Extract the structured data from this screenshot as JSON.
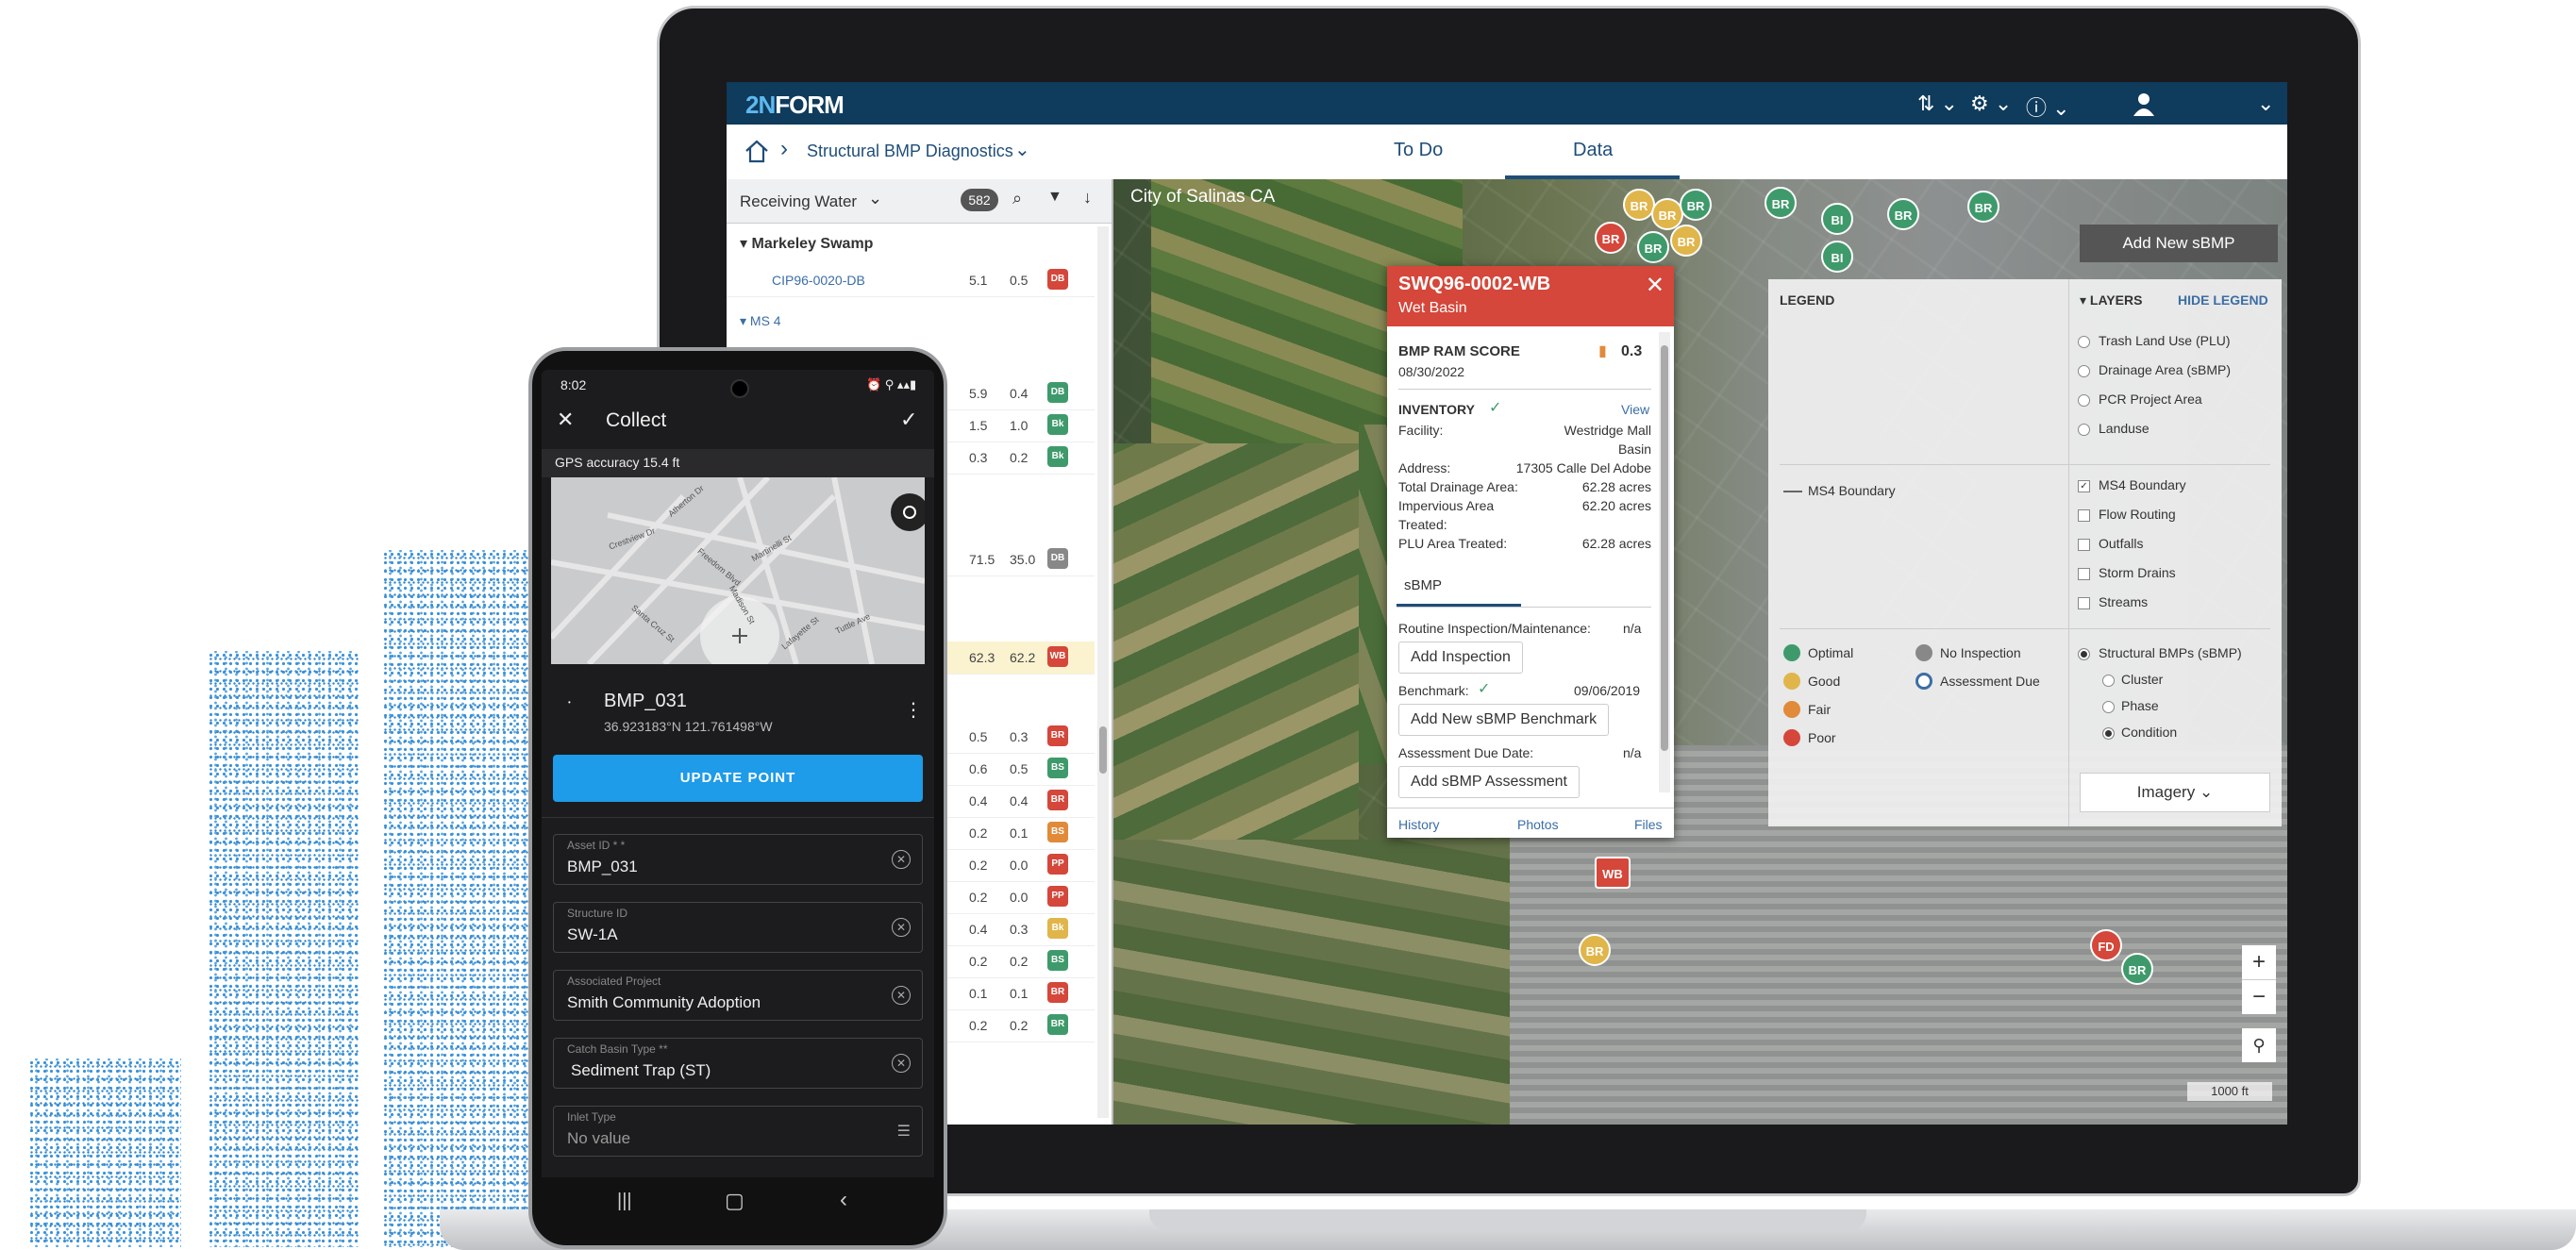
{
  "app": {
    "logo_prefix": "2N",
    "logo_suffix": "FORM",
    "breadcrumb": "Structural BMP Diagnostics",
    "tabs": [
      "To Do",
      "Data"
    ]
  },
  "list": {
    "filter_label": "Receiving Water",
    "count": "582",
    "group1": "Markeley Swamp",
    "group2": "MS 4",
    "rows": [
      {
        "name": "CIP96-0020-DB",
        "v1": "5.1",
        "v2": "0.5",
        "tag": "DB",
        "color": "#d4473a"
      },
      {
        "name": "",
        "v1": "5.9",
        "v2": "0.4",
        "tag": "DB",
        "color": "#3f9a6b"
      },
      {
        "name": "",
        "v1": "1.5",
        "v2": "1.0",
        "tag": "Bk",
        "color": "#3f9a6b"
      },
      {
        "name": "",
        "v1": "0.3",
        "v2": "0.2",
        "tag": "Bk",
        "color": "#3f9a6b"
      },
      {
        "name": "",
        "v1": "71.5",
        "v2": "35.0",
        "tag": "DB",
        "color": "#888888"
      },
      {
        "name": "",
        "v1": "62.3",
        "v2": "62.2",
        "tag": "WB",
        "color": "#d4473a"
      },
      {
        "name": "",
        "v1": "0.5",
        "v2": "0.3",
        "tag": "BR",
        "color": "#d4473a"
      },
      {
        "name": "",
        "v1": "0.6",
        "v2": "0.5",
        "tag": "BS",
        "color": "#3f9a6b"
      },
      {
        "name": "",
        "v1": "0.4",
        "v2": "0.4",
        "tag": "BR",
        "color": "#d4473a"
      },
      {
        "name": "",
        "v1": "0.2",
        "v2": "0.1",
        "tag": "BS",
        "color": "#e08a3a"
      },
      {
        "name": "",
        "v1": "0.2",
        "v2": "0.0",
        "tag": "PP",
        "color": "#d4473a"
      },
      {
        "name": "",
        "v1": "0.2",
        "v2": "0.0",
        "tag": "PP",
        "color": "#d4473a"
      },
      {
        "name": "",
        "v1": "0.4",
        "v2": "0.3",
        "tag": "Bk",
        "color": "#e0b54a"
      },
      {
        "name": "",
        "v1": "0.2",
        "v2": "0.2",
        "tag": "BS",
        "color": "#3f9a6b"
      },
      {
        "name": "",
        "v1": "0.1",
        "v2": "0.1",
        "tag": "BR",
        "color": "#d4473a"
      },
      {
        "name": "",
        "v1": "0.2",
        "v2": "0.2",
        "tag": "BR",
        "color": "#3f9a6b"
      }
    ]
  },
  "map": {
    "city_label": "City of Salinas CA",
    "add_button": "Add New sBMP",
    "scale": "1000 ft",
    "zoom_in": "+",
    "zoom_out": "−",
    "marker_wb": "WB"
  },
  "popup": {
    "title": "SWQ96-0002-WB",
    "subtitle": "Wet Basin",
    "score_label": "BMP RAM SCORE",
    "score_value": "0.3",
    "score_date": "08/30/2022",
    "inventory_label": "INVENTORY",
    "view_link": "View",
    "facility_label": "Facility:",
    "facility_value_1": "Westridge Mall",
    "facility_value_2": "Basin",
    "address_label": "Address:",
    "address_value": "17305 Calle Del Adobe",
    "total_drainage_label": "Total Drainage Area:",
    "total_drainage_value": "62.28 acres",
    "impervious_label": "Impervious Area",
    "impervious_value": "62.20 acres",
    "treated_label": "Treated:",
    "plu_label": "PLU Area Treated:",
    "plu_value": "62.28 acres",
    "tab": "sBMP",
    "routine_label": "Routine Inspection/Maintenance:",
    "routine_value": "n/a",
    "add_inspection": "Add Inspection",
    "benchmark_label": "Benchmark:",
    "benchmark_date": "09/06/2019",
    "add_benchmark": "Add New sBMP Benchmark",
    "assessment_label": "Assessment Due Date:",
    "assessment_value": "n/a",
    "add_assessment": "Add sBMP Assessment",
    "history": "History",
    "photos": "Photos",
    "files": "Files"
  },
  "legend": {
    "title": "LEGEND",
    "layers_title": "LAYERS",
    "hide": "HIDE LEGEND",
    "ms4_line": "MS4 Boundary",
    "layers": [
      "Trash Land Use (PLU)",
      "Drainage Area (sBMP)",
      "PCR Project Area",
      "Landuse"
    ],
    "overlays": [
      "MS4 Boundary",
      "Flow Routing",
      "Outfalls",
      "Storm Drains",
      "Streams"
    ],
    "bmp_title": "Structural BMPs (sBMP)",
    "bmp_modes": [
      "Cluster",
      "Phase",
      "Condition"
    ],
    "conditions": [
      {
        "label": "Optimal",
        "color": "#3f9a6b"
      },
      {
        "label": "Good",
        "color": "#e0b54a"
      },
      {
        "label": "Fair",
        "color": "#e08a3a"
      },
      {
        "label": "Poor",
        "color": "#d4473a"
      }
    ],
    "status": [
      {
        "label": "No Inspection",
        "color": "#888888"
      },
      {
        "label": "Assessment Due",
        "color": "#3b6ea5"
      }
    ],
    "imagery": "Imagery"
  },
  "phone": {
    "time": "8:02",
    "title": "Collect",
    "gps": "GPS accuracy 15.4 ft",
    "point_name": "BMP_031",
    "coords": "36.923183°N  121.761498°W",
    "update": "UPDATE POINT",
    "fields": [
      {
        "label": "Asset ID * *",
        "value": "BMP_031"
      },
      {
        "label": "Structure ID",
        "value": "SW-1A"
      },
      {
        "label": "Associated Project",
        "value": "Smith Community Adoption"
      },
      {
        "label": "Catch Basin Type **",
        "value": "Sediment Trap (ST)"
      },
      {
        "label": "Inlet Type",
        "value": "No value"
      }
    ],
    "streets": [
      "Atherton Dr",
      "Crestview Dr",
      "Freedom Blvd",
      "Martinelli St",
      "Santa Cruz St",
      "Madison St",
      "Lafayette St",
      "Tuttle Ave"
    ]
  }
}
